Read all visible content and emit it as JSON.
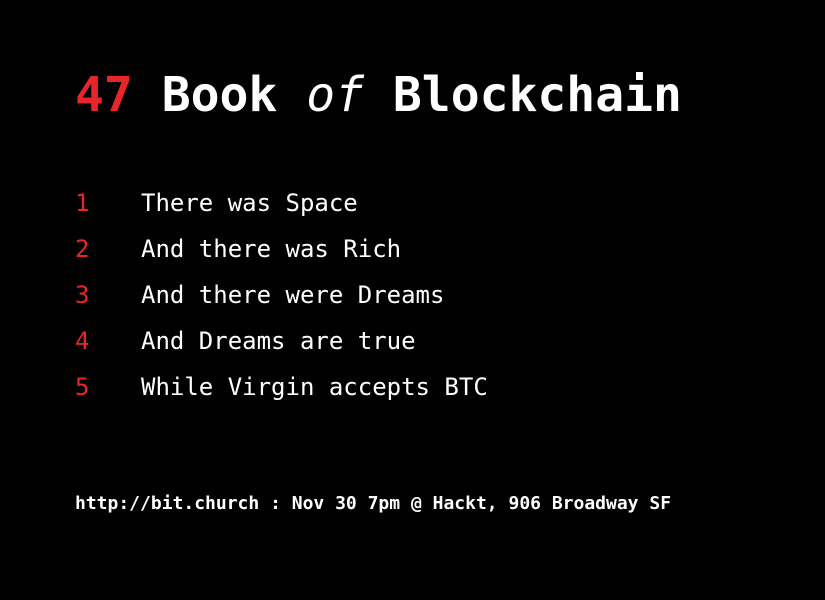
{
  "colors": {
    "background": "#000000",
    "accent": "#e8262a",
    "text": "#ffffff"
  },
  "title": {
    "number": "47",
    "word1": "Book",
    "word2": "of",
    "word3": "Blockchain"
  },
  "verses": [
    {
      "num": "1",
      "text": "There was Space"
    },
    {
      "num": "2",
      "text": "And there was Rich"
    },
    {
      "num": "3",
      "text": "And there were Dreams"
    },
    {
      "num": "4",
      "text": "And Dreams are true"
    },
    {
      "num": "5",
      "text": "While Virgin accepts BTC"
    }
  ],
  "footer": "http://bit.church : Nov 30 7pm @ Hackt, 906 Broadway SF"
}
